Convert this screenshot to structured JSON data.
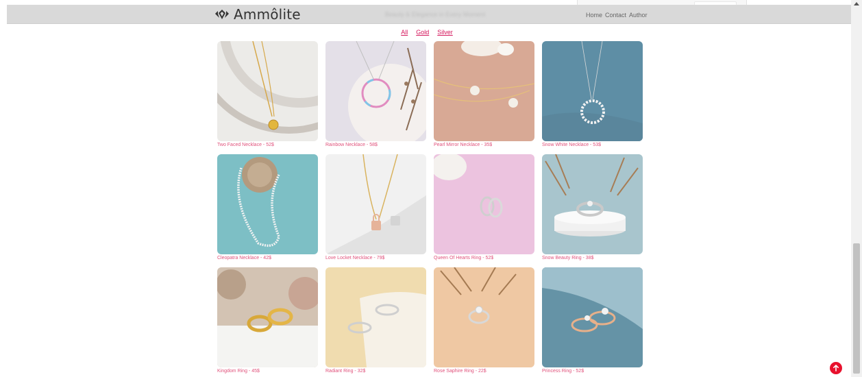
{
  "header": {
    "brand": "Ammôlite",
    "tagline": "Beauty & Elegance in Every Moment",
    "nav": [
      "Home",
      "Contact",
      "Author"
    ]
  },
  "filters": [
    "All",
    "Gold",
    "Silver"
  ],
  "products": [
    {
      "caption": "Two Faced Necklace - 52$",
      "icon": "gold-necklace-image",
      "bg": "#e9e6e1"
    },
    {
      "caption": "Rainbow Necklace - 58$",
      "icon": "rainbow-necklace-image",
      "bg": "#e6e2ea"
    },
    {
      "caption": "Pearl Mirror Necklace - 35$",
      "icon": "pearl-necklace-image",
      "bg": "#d9ab98"
    },
    {
      "caption": "Snow White Necklace - 53$",
      "icon": "snow-necklace-image",
      "bg": "#5f8fa6"
    },
    {
      "caption": "Cleopatra Necklace - 42$",
      "icon": "tennis-necklace-image",
      "bg": "#7cbfc6"
    },
    {
      "caption": "Love Locket Necklace - 79$",
      "icon": "locket-necklace-image",
      "bg": "#efefef"
    },
    {
      "caption": "Queen Of Hearts Ring - 52$",
      "icon": "heart-ring-image",
      "bg": "#ebc3df"
    },
    {
      "caption": "Snow Beauty Ring - 38$",
      "icon": "snow-ring-image",
      "bg": "#a6c4cc"
    },
    {
      "caption": "Kingdom Ring - 45$",
      "icon": "gold-bands-image",
      "bg": "#d8cbbb"
    },
    {
      "caption": "Radiant Ring - 32$",
      "icon": "radiant-ring-image",
      "bg": "#f0dcae"
    },
    {
      "caption": "Rose Saphire Ring - 22$",
      "icon": "solitaire-ring-image",
      "bg": "#f0c9a5"
    },
    {
      "caption": "Princess Ring - 52$",
      "icon": "princess-ring-image",
      "bg": "#5f90a3"
    }
  ],
  "colors": {
    "accent": "#e0507a",
    "filter_link": "#d4145a",
    "header_bg": "#d9d9d9",
    "back_to_top": "#e8112d"
  }
}
